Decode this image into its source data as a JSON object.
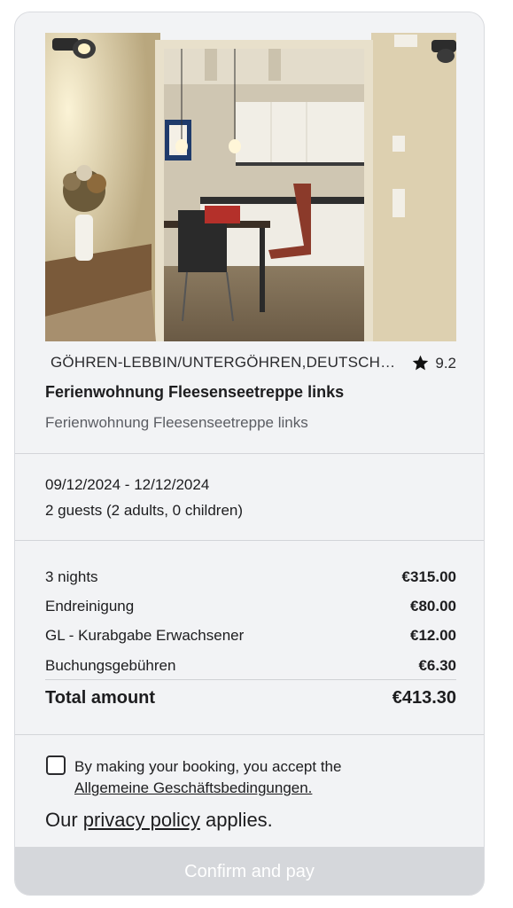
{
  "listing": {
    "image_alt": "Apartment interior with kitchen and dining table",
    "location": "GÖHREN-LEBBIN/UNTERGÖHREN,DEUTSCHLAND",
    "rating": "9.2",
    "rating_icon": "star-icon",
    "title": "Ferienwohnung Fleesenseetreppe links",
    "subtitle": "Ferienwohnung Fleesenseetreppe links"
  },
  "booking": {
    "dates": "09/12/2024 - 12/12/2024",
    "guests": "2 guests (2 adults, 0 children)"
  },
  "price_breakdown": {
    "items": [
      {
        "label": "3 nights",
        "amount": "€315.00"
      },
      {
        "label": "Endreinigung",
        "amount": "€80.00"
      },
      {
        "label": "GL - Kurabgabe Erwachsener",
        "amount": "€12.00"
      },
      {
        "label": "Buchungsgebühren",
        "amount": "€6.30"
      }
    ],
    "total_label": "Total amount",
    "total_amount": "€413.30"
  },
  "terms": {
    "checked": false,
    "text": "By making your booking, you accept the",
    "link_text": "Allgemeine Geschäftsbedingungen."
  },
  "privacy": {
    "prefix": "Our ",
    "link_text": "privacy policy",
    "suffix": " applies."
  },
  "actions": {
    "confirm_label": "Confirm and pay"
  },
  "colors": {
    "card_background": "#f2f3f5",
    "button_disabled": "#d5d7db",
    "text_primary": "#1d1d1f",
    "text_secondary": "#5b5d63"
  }
}
